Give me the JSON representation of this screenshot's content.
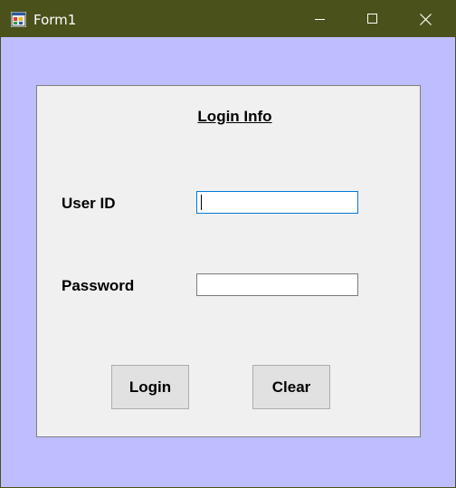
{
  "window": {
    "title": "Form1",
    "app_icon": "winforms-app-icon",
    "controls": {
      "minimize_icon": "minimize-icon",
      "maximize_icon": "maximize-icon",
      "close_icon": "close-icon"
    },
    "colors": {
      "titlebar": "#4b511b",
      "background": "#bebdff",
      "panel": "#f0f0f0",
      "focus_border": "#0078d7"
    }
  },
  "form": {
    "heading": "Login Info",
    "user_id": {
      "label": "User ID",
      "value": ""
    },
    "password": {
      "label": "Password",
      "value": ""
    },
    "buttons": {
      "login": "Login",
      "clear": "Clear"
    }
  }
}
